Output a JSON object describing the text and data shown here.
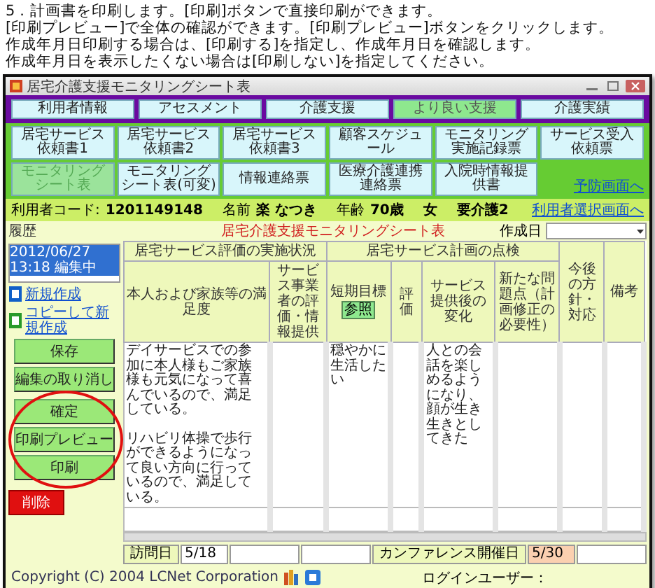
{
  "instructions": [
    "5．計画書を印刷します。[印刷]ボタンで直接印刷ができます。",
    "[印刷プレビュー]で全体の確認ができます。[印刷プレビュー]ボタンをクリックします。",
    "作成年月日印刷する場合は、[印刷する]を指定し、作成年月日を確認します。",
    "作成年月日を表示したくない場合は[印刷しない]を指定してください。"
  ],
  "window": {
    "title": "居宅介護支援モニタリングシート表"
  },
  "nav_primary": [
    {
      "label": "利用者情報",
      "selected": false
    },
    {
      "label": "アセスメント",
      "selected": false
    },
    {
      "label": "介護支援",
      "selected": false
    },
    {
      "label": "より良い支援",
      "selected": true
    },
    {
      "label": "介護実績",
      "selected": false
    }
  ],
  "nav_secondary": [
    {
      "label": "居宅サービス依頼書1",
      "selected": false
    },
    {
      "label": "居宅サービス依頼書2",
      "selected": false
    },
    {
      "label": "居宅サービス依頼書3",
      "selected": false
    },
    {
      "label": "顧客スケジュール",
      "selected": false
    },
    {
      "label": "モニタリング実施記録票",
      "selected": false
    },
    {
      "label": "サービス受入依頼票",
      "selected": false
    },
    {
      "label": "モニタリングシート表",
      "selected": true
    },
    {
      "label": "モニタリングシート表(可変)",
      "selected": false
    },
    {
      "label": "情報連絡票",
      "selected": false
    },
    {
      "label": "医療介護連携連絡票",
      "selected": false
    },
    {
      "label": "入院時情報提供書",
      "selected": false
    }
  ],
  "preventive_link": "予防画面へ",
  "user": {
    "code_label": "利用者コード:",
    "code": "1201149148",
    "name_label": "名前",
    "name": "楽 なつき",
    "age_label": "年齢",
    "age": "70歳",
    "sex": "女",
    "care_level": "要介護2",
    "select_link": "利用者選択画面へ"
  },
  "history": {
    "label": "履歴",
    "items": [
      {
        "text": "2012/06/27 13:18 編集中",
        "selected": true
      }
    ]
  },
  "sheet_title": "居宅介護支援モニタリングシート表",
  "created": {
    "label": "作成日"
  },
  "actions": {
    "links": [
      {
        "kind": "new",
        "label": "新規作成"
      },
      {
        "kind": "copy",
        "label": "コピーして新規作成"
      }
    ],
    "buttons": [
      {
        "label": "保存",
        "highlighted": false
      },
      {
        "label": "編集の取り消し",
        "highlighted": false
      },
      {
        "label": "確定",
        "highlighted": true
      },
      {
        "label": "印刷プレビュー",
        "highlighted": true
      },
      {
        "label": "印刷",
        "highlighted": true
      }
    ],
    "delete": "削除"
  },
  "table": {
    "header": [
      {
        "label": "居宅サービス評価の実施状況",
        "columns": [
          {
            "label": "本人および家族等の満足度"
          },
          {
            "label": "サービス事業者の評価・情報提供"
          }
        ]
      },
      {
        "label": "居宅サービス計画の点検",
        "columns": [
          {
            "label": "短期目標",
            "button": "参照"
          },
          {
            "label": "評価"
          },
          {
            "label": "サービス提供後の変化"
          },
          {
            "label": "新たな問題点（計画修正の必要性）"
          }
        ]
      },
      {
        "label": "今後の方針・対応"
      },
      {
        "label": "備考"
      }
    ],
    "rows": [
      {
        "cells": [
          {
            "paragraphs": [
              "デイサービスでの参加に本人様もご家族様も元気になって喜んでいるので、満足している。",
              "リハビリ体操で歩行ができるようになって良い方向に行っているので、満足している。"
            ]
          },
          {},
          {
            "paragraphs": [
              "穏やかに生活したい"
            ]
          },
          {},
          {
            "paragraphs": [
              "人との会話を楽しめるようになり、顔が生き生きとしてきた"
            ]
          },
          {},
          {},
          {}
        ]
      },
      {
        "cells": [
          {},
          {},
          {},
          {},
          {},
          {},
          {},
          {}
        ]
      }
    ]
  },
  "visit": {
    "label": "訪問日",
    "value": "5/18"
  },
  "conference": {
    "label": "カンファレンス開催日",
    "value": "5/30"
  },
  "footer": {
    "copyright": "Copyright (C) 2004 LCNet Corporation",
    "login_label": "ログインユーザー："
  }
}
